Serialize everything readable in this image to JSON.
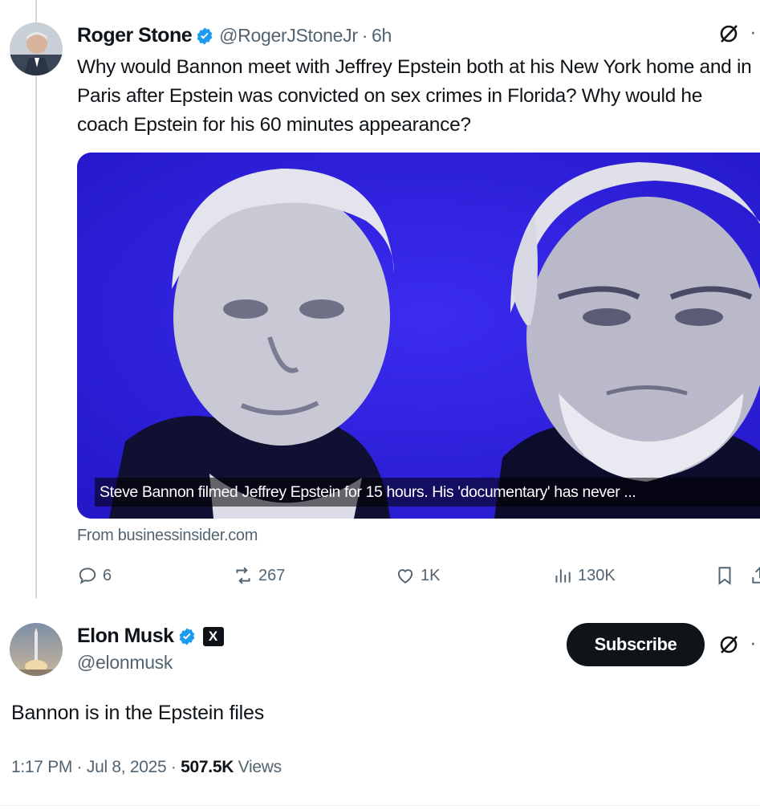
{
  "quoted_tweet": {
    "author_name": "Roger Stone",
    "author_handle": "@RogerJStoneJr",
    "separator": "·",
    "time": "6h",
    "text": "Why would Bannon meet with Jeffrey Epstein both at his New York home and in Paris after Epstein was convicted on sex crimes in Florida? Why would he coach Epstein for his 60 minutes appearance?",
    "media_caption": "Steve Bannon filmed Jeffrey Epstein for 15 hours. His 'documentary' has never ...",
    "source": "From businessinsider.com",
    "actions": {
      "replies": "6",
      "reposts": "267",
      "likes": "1K",
      "views": "130K"
    },
    "icons": [
      "grok-icon",
      "more-icon",
      "verified-badge-icon",
      "reply-icon",
      "repost-icon",
      "like-icon",
      "views-icon",
      "bookmark-icon"
    ]
  },
  "main_tweet": {
    "author_name": "Elon Musk",
    "author_handle": "@elonmusk",
    "affiliate_badge": "X",
    "subscribe_label": "Subscribe",
    "text": "Bannon is in the Epstein files",
    "time": "1:17 PM",
    "date": "Jul 8, 2025",
    "views_count": "507.5K",
    "views_label": "Views",
    "sep": "·"
  },
  "colors": {
    "accent_verified": "#1d9bf0",
    "text_primary": "#0f1419",
    "text_secondary": "#536471",
    "media_blue": "#2f20e6"
  }
}
